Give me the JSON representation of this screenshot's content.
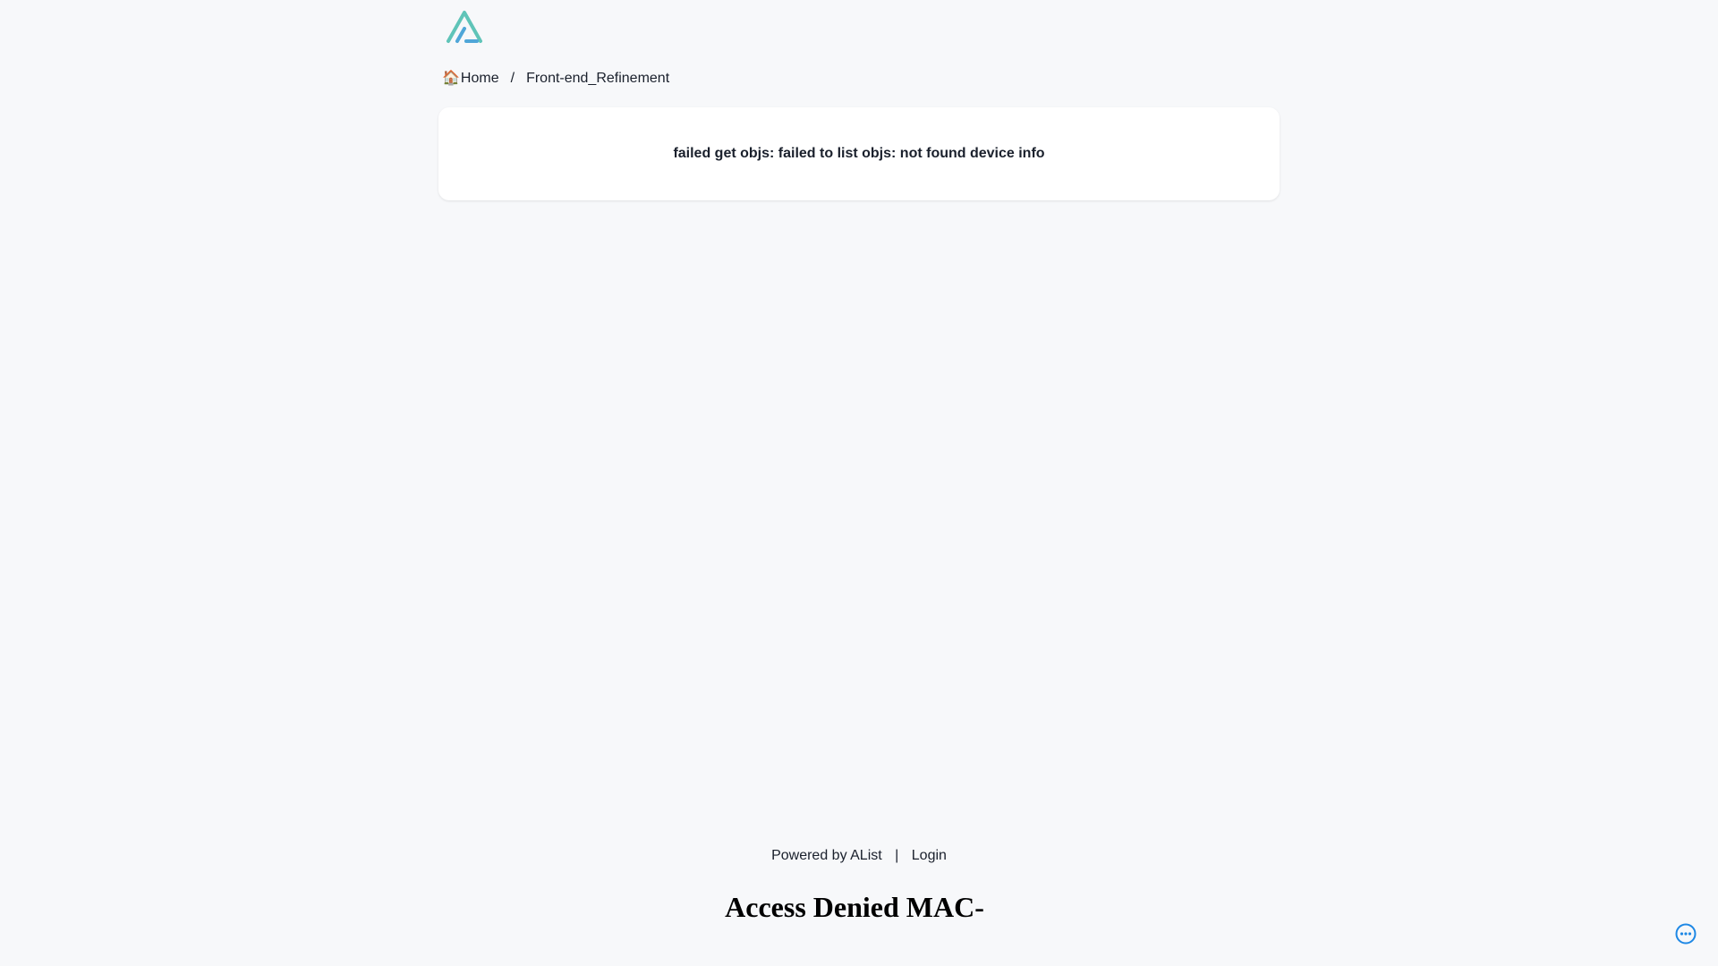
{
  "header": {
    "logo_name": "alist-logo",
    "colors": {
      "logo_teal": "#5fc4b8",
      "logo_blue": "#4fa6d8"
    }
  },
  "breadcrumb": {
    "home_icon": "🏠",
    "home_label": "Home",
    "separator": "/",
    "current_label": "Front-end_Refinement"
  },
  "main": {
    "error_message": "failed get objs: failed to list objs: not found device info"
  },
  "footer": {
    "powered_by": "Powered by AList",
    "pipe": "|",
    "login_label": "Login"
  },
  "overlay": {
    "access_denied_text": "Access Denied MAC-"
  },
  "floating": {
    "more_icon": "more-horizontal-icon",
    "accent_color": "#1e88e5"
  }
}
